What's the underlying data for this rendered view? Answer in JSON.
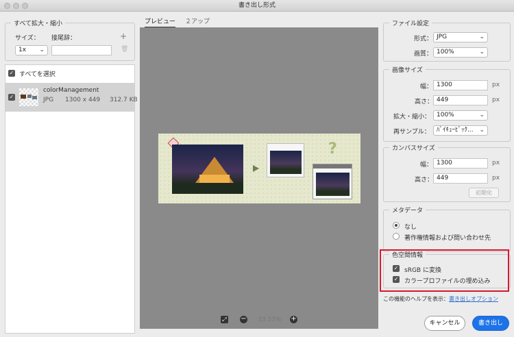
{
  "window": {
    "title": "書き出し形式"
  },
  "left": {
    "scale_all_legend": "すべて拡大・縮小",
    "size_label": "サイズ：",
    "suffix_label": "接尾辞：",
    "add_icon": "+",
    "size_value": "1x",
    "suffix_value": "",
    "select_all_label": "すべてを選択",
    "file": {
      "name": "colorManagement",
      "format": "JPG",
      "dimensions": "1300 x 449",
      "size": "312.7 KB"
    }
  },
  "tabs": [
    {
      "label": "プレビュー"
    },
    {
      "label": "２アップ"
    }
  ],
  "zoom": {
    "value": "33.33%"
  },
  "file_settings": {
    "legend": "ファイル設定",
    "format_label": "形式：",
    "format_value": "JPG",
    "quality_label": "画質：",
    "quality_value": "100%"
  },
  "image_size": {
    "legend": "画像サイズ",
    "width_label": "幅：",
    "width_value": "1300",
    "height_label": "高さ：",
    "height_value": "449",
    "scale_label": "拡大・縮小：",
    "scale_value": "100%",
    "resample_label": "再サンプル：",
    "resample_value": "ﾊﾞｲｷｭｰﾋﾞｯｸ...",
    "unit": "px"
  },
  "canvas_size": {
    "legend": "カンバスサイズ",
    "width_label": "幅：",
    "width_value": "1300",
    "height_label": "高さ：",
    "height_value": "449",
    "unit": "px",
    "reset_label": "初期化"
  },
  "metadata": {
    "legend": "メタデータ",
    "option_none": "なし",
    "option_copyright": "著作権情報および問い合わせ先"
  },
  "color_space": {
    "legend": "色空間情報",
    "convert_srgb": "sRGB に変換",
    "embed_profile": "カラープロファイルの埋め込み"
  },
  "help": {
    "prefix": "この機能のヘルプを表示：",
    "link": "書き出しオプション"
  },
  "buttons": {
    "cancel": "キャンセル",
    "export": "書き出し"
  },
  "colors": {
    "accent": "#1d73e8",
    "highlight_box": "#d6182f",
    "preview_bg": "#8a8a8a"
  }
}
